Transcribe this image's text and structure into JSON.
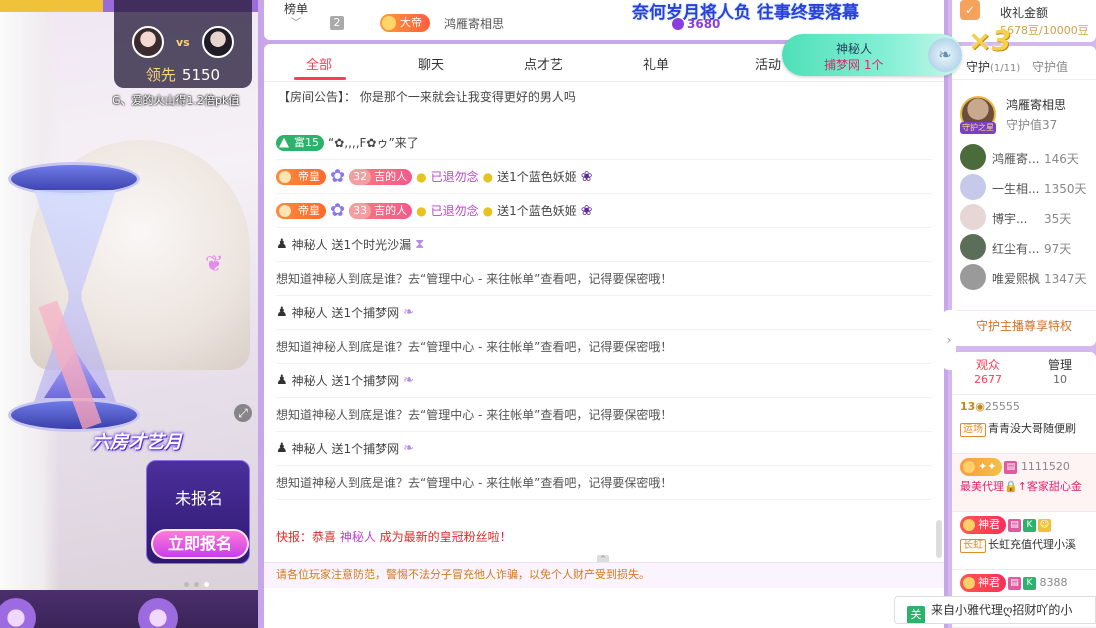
{
  "video": {
    "pk": {
      "vs": "vs",
      "lead_label": "领先",
      "lead_value": "5150"
    },
    "scroll_text": "G、爱的火山得1.2倍pk值",
    "activity_title": "六房才艺月",
    "signup_status": "未报名",
    "signup_button": "立即报名"
  },
  "rank_bar": {
    "label": "榜单",
    "rank_num": "2",
    "badge": "大帝",
    "user": "鸿雁寄相思",
    "poem": "奈何岁月将人负 往事终要落幕",
    "score": "3680"
  },
  "chat": {
    "tabs": [
      "全部",
      "聊天",
      "点才艺",
      "礼单",
      "活动"
    ],
    "notice": "【房间公告】： 你是那个一来就会让我变得更好的男人吗",
    "entry": {
      "level": "富15",
      "name": "“✿,,,,F✿ゥ”来了"
    },
    "gift_msgs": [
      {
        "badge": "帝皇",
        "level": "32",
        "title": "吉的人",
        "nick": "已退勿念",
        "text": "送1个蓝色妖姬"
      },
      {
        "badge": "帝皇",
        "level": "33",
        "title": "吉的人",
        "nick": "已退勿念",
        "text": "送1个蓝色妖姬"
      }
    ],
    "mystery_msgs": [
      {
        "text": "神秘人 送1个时光沙漏"
      },
      {
        "text": "想知道神秘人到底是谁？去“管理中心 - 来往帐单”查看吧，记得要保密哦！"
      },
      {
        "text": "神秘人 送1个捕梦网"
      },
      {
        "text": "想知道神秘人到底是谁？去“管理中心 - 来往帐单”查看吧，记得要保密哦！"
      },
      {
        "text": "神秘人 送1个捕梦网"
      },
      {
        "text": "想知道神秘人到底是谁？去“管理中心 - 来往帐单”查看吧，记得要保密哦！"
      },
      {
        "text": "神秘人 送1个捕梦网"
      },
      {
        "text": "想知道神秘人到底是谁？去“管理中心 - 来往帐单”查看吧，记得要保密哦！"
      }
    ],
    "flash_prefix": "快报：恭喜 ",
    "flash_name": "神秘人",
    "flash_suffix": " 成为最新的皇冠粉丝啦！",
    "warning": "请各位玩家注意防范，警惕不法分子冒充他人诈骗，以免个人财产受到损失。"
  },
  "mystery_banner": {
    "title": "神秘人",
    "gift": "捕梦网",
    "count": "1个"
  },
  "gift_card": {
    "label": "收礼金额",
    "value": "5678豆/10000豆"
  },
  "multiplier": "×3",
  "guard": {
    "tab_label": "守护",
    "tab_count": "(1/11)",
    "tab_value": "守护值",
    "top1_badge": "守护之星",
    "top1_name": "鸿雁寄相思",
    "top1_value": "守护值37",
    "members": [
      {
        "name": "鸿雁寄...",
        "days": "146天",
        "color": "#4b6b3a"
      },
      {
        "name": "一生相...",
        "days": "1350天",
        "color": "#c7c9ea"
      },
      {
        "name": "博宇...",
        "days": "35天",
        "color": "#e6d6d6"
      },
      {
        "name": "红尘有...",
        "days": "97天",
        "color": "#5a6e5a"
      },
      {
        "name": "唯爱熙枫",
        "days": "1347天",
        "color": "#9a9a9a"
      }
    ],
    "privilege": "守护主播尊享特权"
  },
  "audience": {
    "tab_audience": "观众",
    "audience_count": "2677",
    "tab_admin": "管理",
    "admin_count": "10",
    "rows": [
      {
        "l1": "25555",
        "tag": "运场",
        "l2": "青青没大哥随便刷"
      },
      {
        "l1": "1111520",
        "pill": "",
        "l2": "最美代理🔒↑客家甜心金"
      },
      {
        "pill": "神君",
        "tag": "长虹",
        "l2": "长虹充值代理小溪"
      },
      {
        "pill": "神君",
        "l1": "8388"
      }
    ]
  },
  "toast": {
    "tag": "关",
    "text": "来自小雅代理ღ招财吖的小"
  }
}
